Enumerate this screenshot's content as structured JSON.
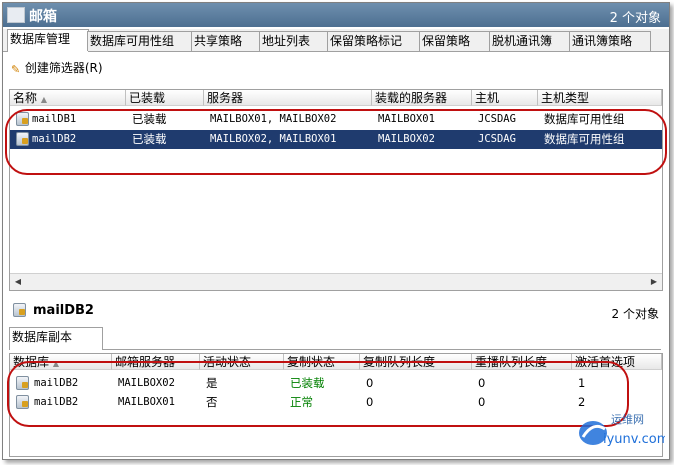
{
  "window": {
    "title": "邮箱",
    "count_label": "2 个对象"
  },
  "tabs": [
    {
      "label": "数据库管理",
      "active": true
    },
    {
      "label": "数据库可用性组",
      "active": false
    },
    {
      "label": "共享策略",
      "active": false
    },
    {
      "label": "地址列表",
      "active": false
    },
    {
      "label": "保留策略标记",
      "active": false
    },
    {
      "label": "保留策略",
      "active": false
    },
    {
      "label": "脱机通讯簿",
      "active": false
    },
    {
      "label": "通讯簿策略",
      "active": false
    }
  ],
  "toolbar": {
    "create_filter_label": "创建筛选器(R)"
  },
  "db_table": {
    "columns": [
      "名称",
      "已装载",
      "服务器",
      "装载的服务器",
      "主机",
      "主机类型"
    ],
    "rows": [
      {
        "name": "mailDB1",
        "mounted": "已装载",
        "servers": "MAILBOX01, MAILBOX02",
        "mounted_server": "MAILBOX01",
        "host": "JCSDAG",
        "host_type": "数据库可用性组",
        "selected": false
      },
      {
        "name": "mailDB2",
        "mounted": "已装载",
        "servers": "MAILBOX02, MAILBOX01",
        "mounted_server": "MAILBOX02",
        "host": "JCSDAG",
        "host_type": "数据库可用性组",
        "selected": true
      }
    ]
  },
  "details": {
    "title": "mailDB2",
    "count_label": "2 个对象",
    "tab_label": "数据库副本",
    "columns": [
      "数据库",
      "邮箱服务器",
      "活动状态",
      "复制状态",
      "复制队列长度",
      "重播队列长度",
      "激活首选项"
    ],
    "rows": [
      {
        "database": "mailDB2",
        "server": "MAILBOX02",
        "active": "是",
        "copy_status": "已装载",
        "copy_queue": "0",
        "replay_queue": "0",
        "preference": "1"
      },
      {
        "database": "mailDB2",
        "server": "MAILBOX01",
        "active": "否",
        "copy_status": "正常",
        "copy_queue": "0",
        "replay_queue": "0",
        "preference": "2"
      }
    ]
  },
  "watermark": {
    "top": "运维网",
    "bottom": "iyunv.com"
  },
  "colors": {
    "selection": "#1f3b6e",
    "highlight_ring": "#c01010",
    "status_green": "#008000",
    "titlebar": "#5a7a9c"
  }
}
